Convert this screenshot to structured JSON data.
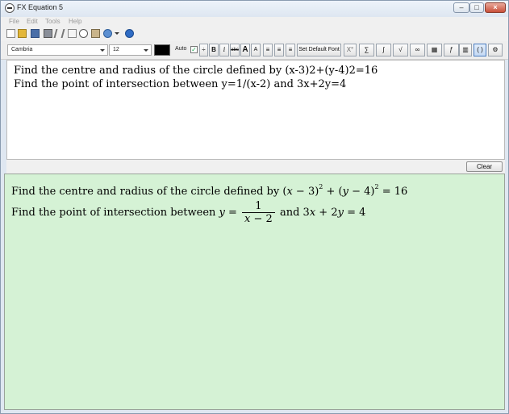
{
  "window": {
    "title": "FX Equation 5"
  },
  "menubar": {
    "items": [
      "File",
      "Edit",
      "Tools",
      "Help"
    ]
  },
  "toolbar1": {
    "icons": [
      "new-icon",
      "open-icon",
      "save-icon",
      "print-icon",
      "cut-icon",
      "copy-icon",
      "paste-icon",
      "preview-icon",
      "graph-icon",
      "help-icon"
    ]
  },
  "toolbar2": {
    "font": "Cambria",
    "size": "12",
    "color": "#000000",
    "auto_label": "Auto",
    "fraction_symbol": "÷",
    "bold": "B",
    "italic": "i",
    "strike": "abc",
    "grow": "A",
    "shrink": "A",
    "set_default_font": "Set Default Font",
    "degree": "X°"
  },
  "editor": {
    "lines": [
      "Find the centre and radius of the circle defined by (x-3)2+(y-4)2=16",
      "Find the point of intersection between y=1/(x-2) and 3x+2y=4"
    ]
  },
  "clear_label": "Clear",
  "output": {
    "line1": {
      "text": "Find the centre and radius of the circle defined by ",
      "t1": "(",
      "v1": "x",
      "t2": " − 3)",
      "e1": "2",
      "t3": " + (",
      "v2": "y",
      "t4": " − 4)",
      "e2": "2",
      "t5": " = 16"
    },
    "line2": {
      "text": "Find the point of intersection between ",
      "v1": "y",
      "eq": " = ",
      "num": "1",
      "den_v": "x",
      "den_rest": " − 2",
      "and": " and 3",
      "v2": "x",
      "plus": " + 2",
      "v3": "y",
      "tail": " = 4"
    }
  },
  "colors": {
    "output_bg": "#d5f2d5",
    "window_bg": "#dfe7f1"
  }
}
